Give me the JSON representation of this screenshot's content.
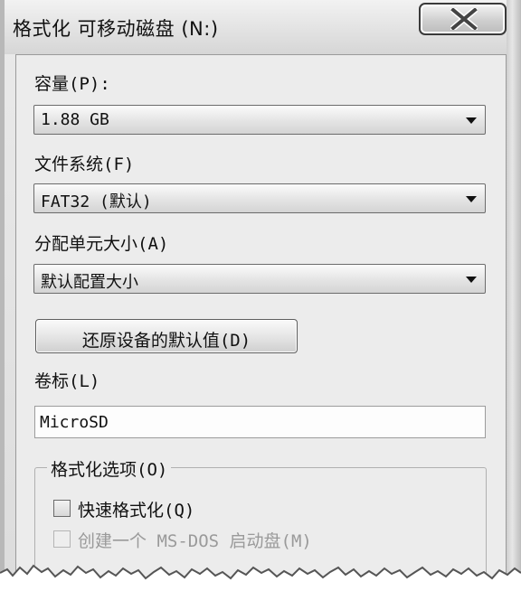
{
  "window": {
    "title": "格式化 可移动磁盘 (N:)",
    "close_icon": "close-x-icon"
  },
  "capacity": {
    "label": "容量(P):",
    "value": "1.88 GB"
  },
  "file_system": {
    "label": "文件系统(F)",
    "value": "FAT32 (默认)"
  },
  "allocation": {
    "label": "分配单元大小(A)",
    "value": "默认配置大小"
  },
  "restore_button": {
    "label": "还原设备的默认值(D)"
  },
  "volume": {
    "label": "卷标(L)",
    "value": "MicroSD"
  },
  "format_options": {
    "title": "格式化选项(O)",
    "quick_format": {
      "label": "快速格式化(Q)",
      "checked": false
    },
    "msdos_boot": {
      "label": "创建一个 MS-DOS 启动盘(M)",
      "checked": false,
      "disabled": true
    }
  },
  "colors": {
    "title_bar": "#e0e0e0",
    "client_bg": "#ececec",
    "text": "#111111",
    "disabled_text": "#9a9a9a"
  }
}
